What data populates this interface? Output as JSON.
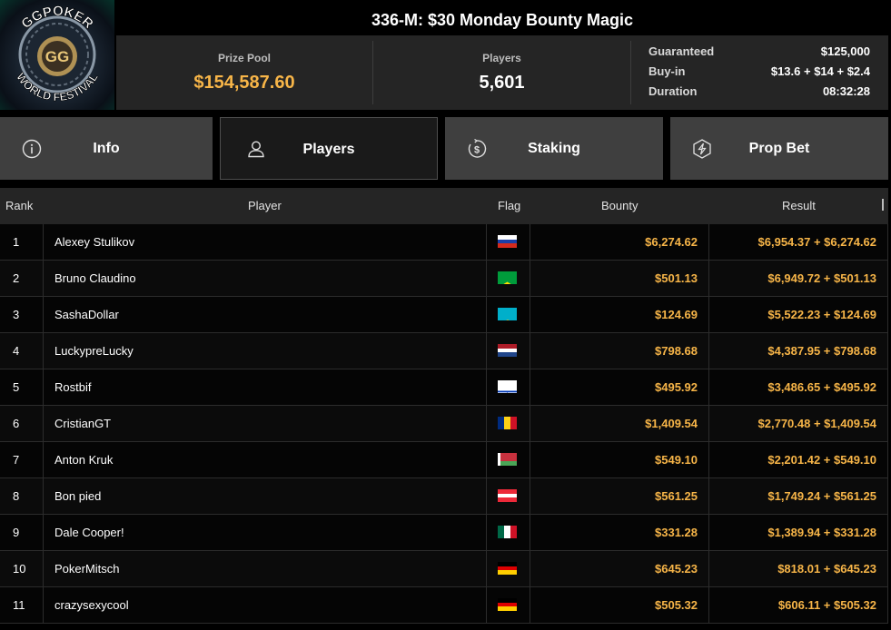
{
  "logo": {
    "top_text": "GGPOKER",
    "bottom_text": "WORLD FESTIVAL",
    "mark": "GG"
  },
  "tournament": {
    "title": "336-M: $30 Monday Bounty Magic",
    "prize_pool_label": "Prize Pool",
    "prize_pool": "$154,587.60",
    "players_label": "Players",
    "players": "5,601",
    "meta": [
      {
        "key": "Guaranteed",
        "value": "$125,000"
      },
      {
        "key": "Buy-in",
        "value": "$13.6 + $14 + $2.4"
      },
      {
        "key": "Duration",
        "value": "08:32:28"
      }
    ]
  },
  "tabs": [
    {
      "label": "Info",
      "icon": "info-icon",
      "active": false
    },
    {
      "label": "Players",
      "icon": "user-icon",
      "active": true
    },
    {
      "label": "Staking",
      "icon": "dollar-coin-icon",
      "active": false
    },
    {
      "label": "Prop Bet",
      "icon": "lightning-icon",
      "active": false
    }
  ],
  "table": {
    "headers": {
      "rank": "Rank",
      "player": "Player",
      "flag": "Flag",
      "bounty": "Bounty",
      "result": "Result"
    },
    "rows": [
      {
        "rank": "1",
        "player": "Alexey Stulikov",
        "flag": "russia",
        "bounty": "$6,274.62",
        "result": "$6,954.37 + $6,274.62"
      },
      {
        "rank": "2",
        "player": "Bruno Claudino",
        "flag": "brazil",
        "bounty": "$501.13",
        "result": "$6,949.72 + $501.13"
      },
      {
        "rank": "3",
        "player": "SashaDollar",
        "flag": "kazakhstan",
        "bounty": "$124.69",
        "result": "$5,522.23 + $124.69"
      },
      {
        "rank": "4",
        "player": "LuckypreLucky",
        "flag": "netherlands",
        "bounty": "$798.68",
        "result": "$4,387.95 + $798.68"
      },
      {
        "rank": "5",
        "player": "Rostbif",
        "flag": "israel",
        "bounty": "$495.92",
        "result": "$3,486.65 + $495.92"
      },
      {
        "rank": "6",
        "player": "CristianGT",
        "flag": "romania",
        "bounty": "$1,409.54",
        "result": "$2,770.48 + $1,409.54"
      },
      {
        "rank": "7",
        "player": "Anton Kruk",
        "flag": "belarus",
        "bounty": "$549.10",
        "result": "$2,201.42 + $549.10"
      },
      {
        "rank": "8",
        "player": "Bon pied",
        "flag": "austria",
        "bounty": "$561.25",
        "result": "$1,749.24 + $561.25"
      },
      {
        "rank": "9",
        "player": "Dale Cooper!",
        "flag": "mexico",
        "bounty": "$331.28",
        "result": "$1,389.94 + $331.28"
      },
      {
        "rank": "10",
        "player": "PokerMitsch",
        "flag": "germany",
        "bounty": "$645.23",
        "result": "$818.01 + $645.23"
      },
      {
        "rank": "11",
        "player": "crazysexycool",
        "flag": "germany",
        "bounty": "$505.32",
        "result": "$606.11 + $505.32"
      }
    ]
  },
  "colors": {
    "accent": "#f7b548",
    "panel": "#252525",
    "tab": "#3f3f3f",
    "active_tab": "#1a1a1a"
  }
}
